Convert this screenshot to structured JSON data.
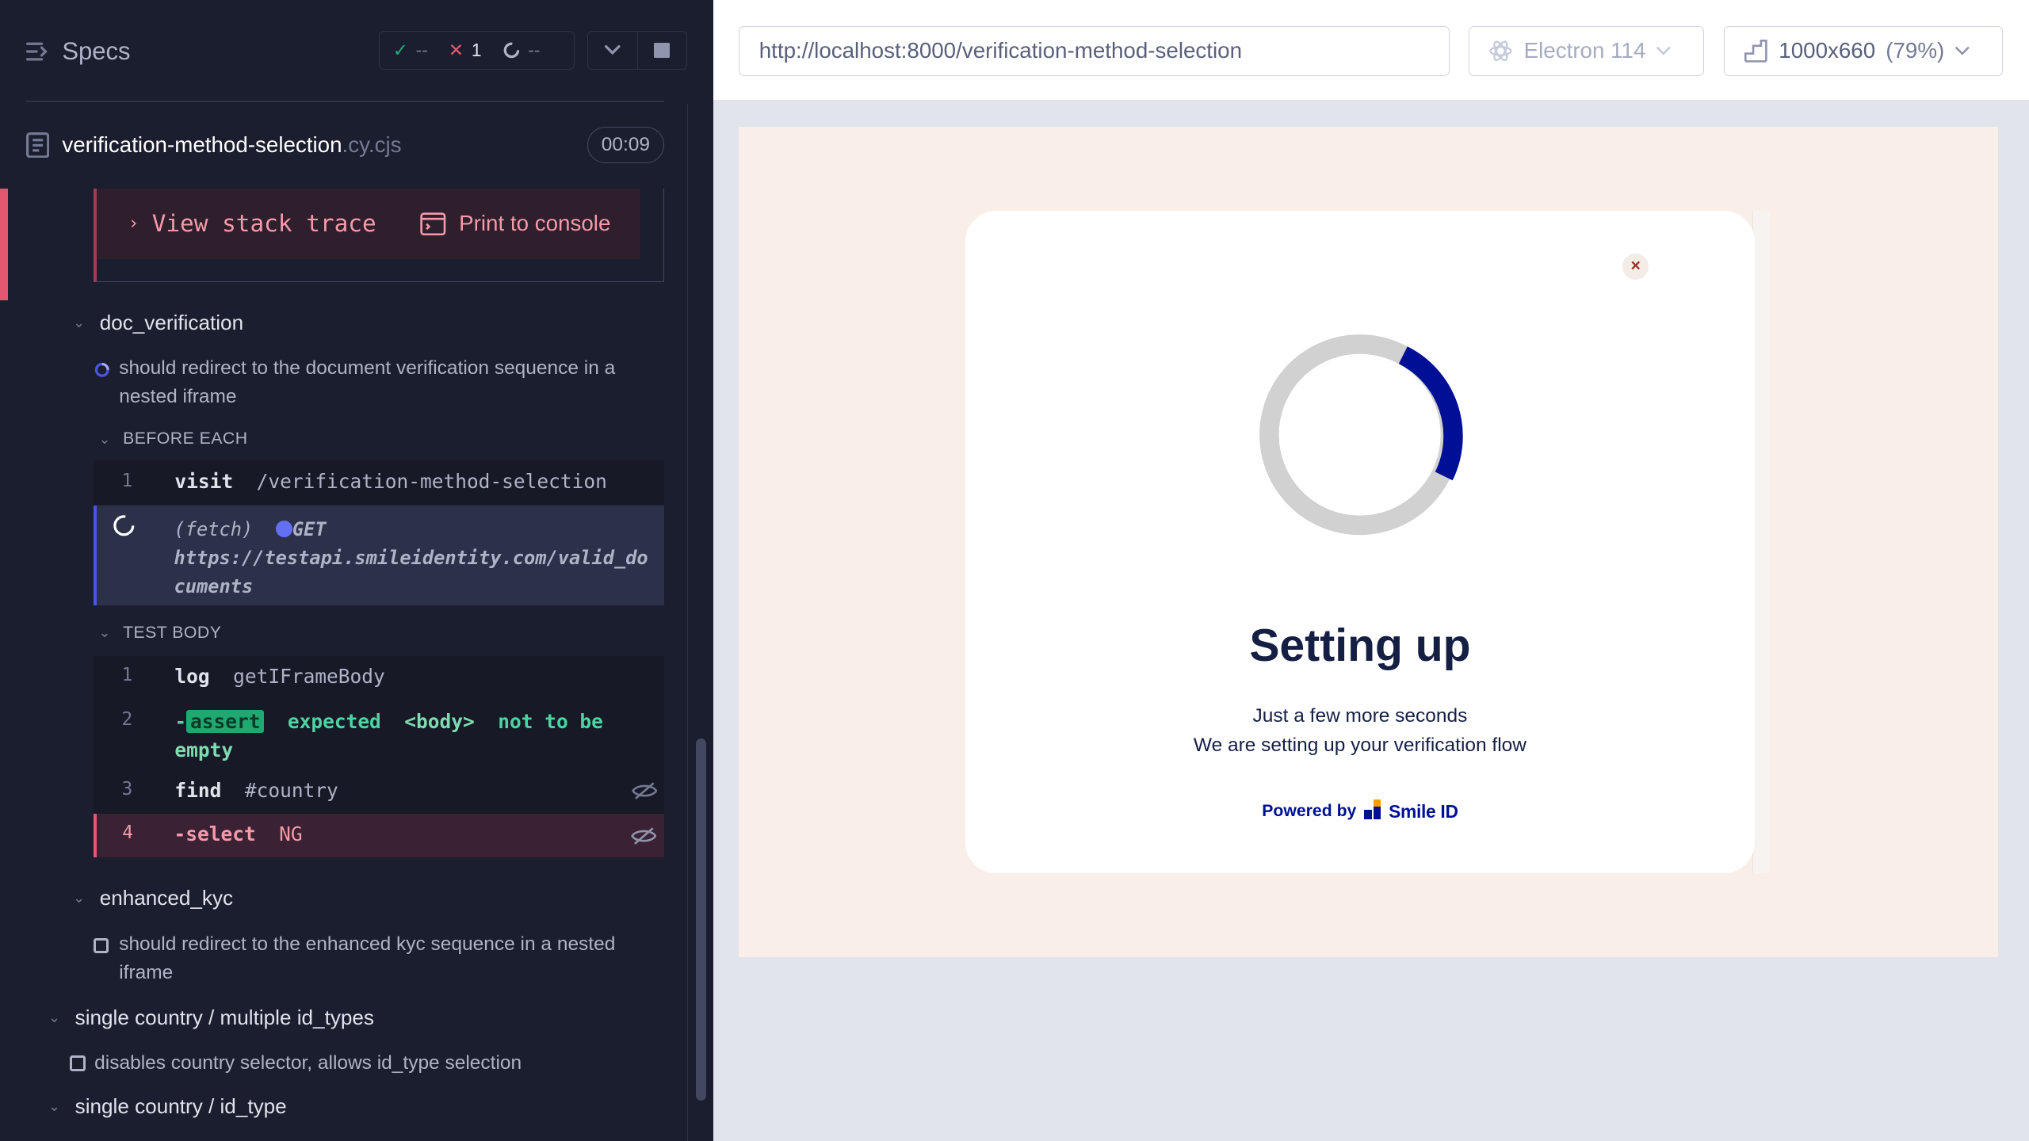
{
  "reporter": {
    "specs_label": "Specs",
    "stats": {
      "passed": "--",
      "failed": "1",
      "pending": "--"
    },
    "spec": {
      "name": "verification-method-selection",
      "ext": ".cy.cjs",
      "duration": "00:09"
    },
    "error": {
      "stack_label": "View stack trace",
      "print_label": "Print to console"
    },
    "suites": [
      {
        "title": "doc_verification"
      },
      {
        "title": "enhanced_kyc"
      },
      {
        "title": "single country / multiple id_types"
      },
      {
        "title": "single country / id_type"
      }
    ],
    "tests": {
      "doc_verification": "should redirect to the document verification sequence in a nested iframe",
      "enhanced_kyc": "should redirect to the enhanced kyc sequence in a nested iframe",
      "multiple_id_types": "disables country selector, allows id_type selection"
    },
    "hooks": {
      "before_each": "BEFORE EACH",
      "test_body": "TEST BODY"
    },
    "before_each_commands": [
      {
        "num": "1",
        "name": "visit",
        "message": "/verification-method-selection"
      }
    ],
    "pending_request": {
      "type": "(fetch)",
      "method": "GET",
      "url_line1": "https://testapi.smileidentity.com/valid_do",
      "url_line2": "cuments"
    },
    "test_body_commands": [
      {
        "num": "1",
        "name": "log",
        "message": "getIFrameBody"
      },
      {
        "num": "2",
        "name": "assert",
        "prefix": "-",
        "expected": "expected",
        "subject": "<body>",
        "phrase": "not to be",
        "tail": "empty"
      },
      {
        "num": "3",
        "name": "find",
        "message": "#country"
      },
      {
        "num": "4",
        "name": "-select",
        "message": "NG"
      }
    ]
  },
  "aut": {
    "url": "http://localhost:8000/verification-method-selection",
    "browser": "Electron 114",
    "viewport": "1000x660",
    "zoom": "(79%)",
    "page": {
      "close_label": "×",
      "title": "Setting up",
      "line1": "Just a few more seconds",
      "line2": "We are setting up your verification flow",
      "powered_by": "Powered by",
      "brand": "Smile ID"
    }
  }
}
